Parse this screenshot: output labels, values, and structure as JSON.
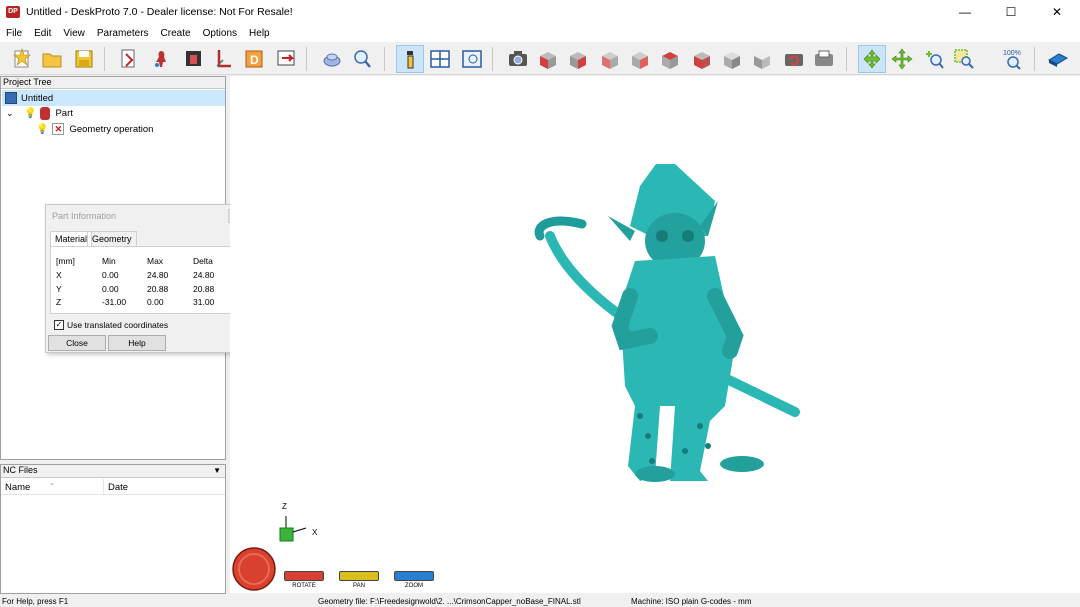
{
  "window": {
    "title": "Untitled - DeskProto 7.0 - Dealer license: Not For Resale!",
    "app_icon_text": "DP",
    "minimize": "—",
    "maximize": "☐",
    "close": "✕"
  },
  "menu": [
    "File",
    "Edit",
    "View",
    "Parameters",
    "Create",
    "Options",
    "Help"
  ],
  "toolbar": {
    "icons": [
      "new-project-icon",
      "open-project-icon",
      "save-project-icon",
      "import-geometry-icon",
      "part-icon",
      "bitmap-icon",
      "vector-icon",
      "drawing-icon",
      "export-icon",
      "measure-icon",
      "preview-icon",
      "info-icon",
      "layout-icon",
      "view-options-icon",
      "camera-icon",
      "view-front-icon",
      "view-back-icon",
      "view-left-icon",
      "view-right-icon",
      "view-top-icon",
      "view-bottom-icon",
      "view-iso-icon",
      "view-iso2-icon",
      "reset-view-icon",
      "print-view-icon",
      "rotate-mode-icon",
      "pan-mode-icon",
      "zoom-mode-icon",
      "zoom-window-icon",
      "zoom-100-icon",
      "book-icon"
    ],
    "zoom_label": "100%"
  },
  "project_tree": {
    "header": "Project Tree",
    "items": [
      {
        "label": "Untitled",
        "level": 0,
        "selected": true
      },
      {
        "label": "Part",
        "level": 1,
        "expander": "⌄"
      },
      {
        "label": "Geometry operation",
        "level": 2
      }
    ]
  },
  "nc_files": {
    "header": "NC Files",
    "columns": [
      "Name",
      "Date"
    ]
  },
  "part_info": {
    "title": "Part Information",
    "tabs": [
      "Material",
      "Geometry"
    ],
    "active_tab": "Material",
    "headers": [
      "[mm]",
      "Min",
      "Max",
      "Delta"
    ],
    "rows": [
      {
        "axis": "X",
        "min": "0.00",
        "max": "24.80",
        "delta": "24.80"
      },
      {
        "axis": "Y",
        "min": "0.00",
        "max": "20.88",
        "delta": "20.88"
      },
      {
        "axis": "Z",
        "min": "-31.00",
        "max": "0.00",
        "delta": "31.00"
      }
    ],
    "checkbox_label": "Use translated coordinates",
    "checkbox_checked": true,
    "close_label": "Close",
    "help_label": "Help"
  },
  "view_controls": {
    "rotate": "ROTATE",
    "pan": "PAN",
    "zoom": "ZOOM",
    "rotate_color": "#d94030",
    "pan_color": "#d8c020",
    "zoom_color": "#2a7fd0"
  },
  "axes": {
    "z": "Z",
    "x": "X"
  },
  "model_color": "#2bb7b4",
  "status": {
    "help": "For Help, press F1",
    "geometry": "Geometry file: F:\\Freedesignwold\\2. ...\\CrimsonCapper_noBase_FINAL.stl",
    "machine": "Machine: ISO plain G-codes - mm"
  }
}
